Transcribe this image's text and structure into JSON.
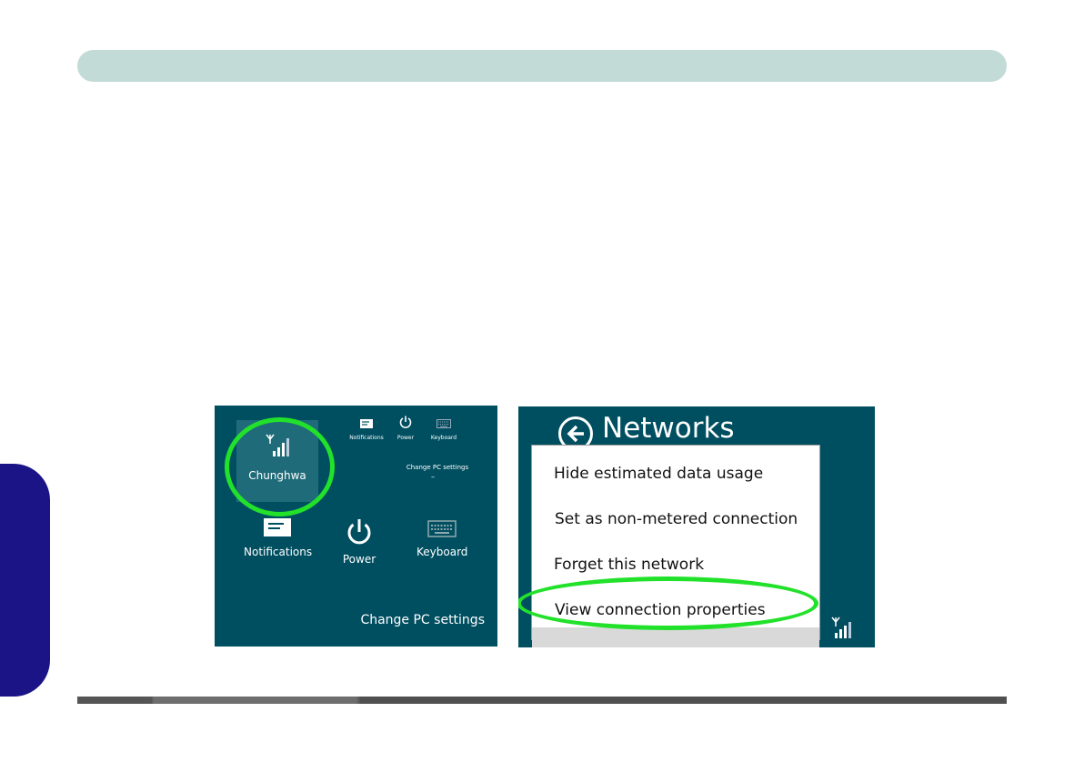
{
  "page": {
    "header_color": "#c3dbd6",
    "side_tab_color": "#1a1487"
  },
  "left_screenshot": {
    "background": "#004f61",
    "network_tile": {
      "icon": "wifi-signal-icon",
      "label": "Chunghwa"
    },
    "small_icons": [
      {
        "icon": "notifications-icon",
        "label": "Notifications"
      },
      {
        "icon": "power-icon",
        "label": "Power"
      },
      {
        "icon": "keyboard-icon",
        "label": "Keyboard"
      }
    ],
    "small_change_settings": "Change PC settings",
    "small_dash": "–",
    "large_icons": [
      {
        "icon": "notifications-icon",
        "label": "Notifications"
      },
      {
        "icon": "power-icon",
        "label": "Power"
      },
      {
        "icon": "keyboard-icon",
        "label": "Keyboard"
      }
    ],
    "change_settings": "Change PC settings",
    "highlight_color": "#22e12a"
  },
  "right_screenshot": {
    "title": "Networks",
    "menu": [
      "Hide estimated data usage",
      "Set as non-metered connection",
      "Forget this network",
      "View connection properties"
    ],
    "highlighted_item": "View connection properties",
    "highlight_color": "#22e12a"
  }
}
